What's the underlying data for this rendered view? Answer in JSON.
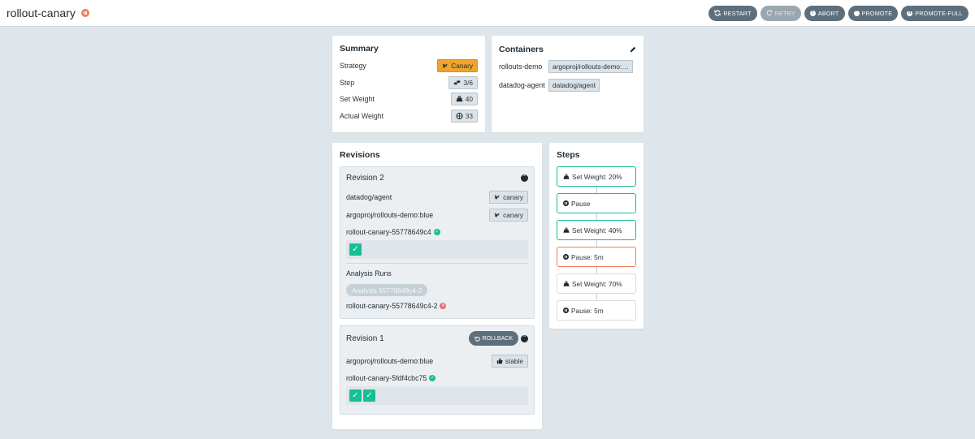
{
  "header": {
    "title": "rollout-canary",
    "actions": {
      "restart": "RESTART",
      "retry": "RETRY",
      "abort": "ABORT",
      "promote": "PROMOTE",
      "promote_full": "PROMOTE-FULL"
    }
  },
  "summary": {
    "title": "Summary",
    "rows": [
      {
        "label": "Strategy",
        "value": "Canary"
      },
      {
        "label": "Step",
        "value": "3/6"
      },
      {
        "label": "Set Weight",
        "value": "40"
      },
      {
        "label": "Actual Weight",
        "value": "33"
      }
    ]
  },
  "containers": {
    "title": "Containers",
    "items": [
      {
        "name": "rollouts-demo",
        "image": "argoproj/rollouts-demo:…"
      },
      {
        "name": "datadog-agent",
        "image": "datadog/agent"
      }
    ]
  },
  "revisions": {
    "title": "Revisions",
    "items": [
      {
        "title": "Revision 2",
        "images": [
          {
            "image": "datadog/agent",
            "tag": "canary"
          },
          {
            "image": "argoproj/rollouts-demo:blue",
            "tag": "canary"
          }
        ],
        "replicaset": "rollout-canary-55778649c4",
        "analysis_label": "Analysis Runs",
        "analysis_pill": "Analysis 55778649c4-2",
        "analysis_run": "rollout-canary-55778649c4-2"
      },
      {
        "title": "Revision 1",
        "rollback": "ROLLBACK",
        "images": [
          {
            "image": "argoproj/rollouts-demo:blue",
            "tag": "stable"
          }
        ],
        "replicaset": "rollout-canary-5fdf4cbc75"
      }
    ]
  },
  "steps": {
    "title": "Steps",
    "items": [
      {
        "label": "Set Weight: 20%"
      },
      {
        "label": "Pause"
      },
      {
        "label": "Set Weight: 40%"
      },
      {
        "label": "Pause: 5m"
      },
      {
        "label": "Set Weight: 70%"
      },
      {
        "label": "Pause: 5m"
      }
    ]
  },
  "colors": {
    "accent_green": "#18be94",
    "current_orange": "#f07d5b",
    "canary_yellow": "#f0a42b",
    "button_gray": "#5e6f7c"
  }
}
